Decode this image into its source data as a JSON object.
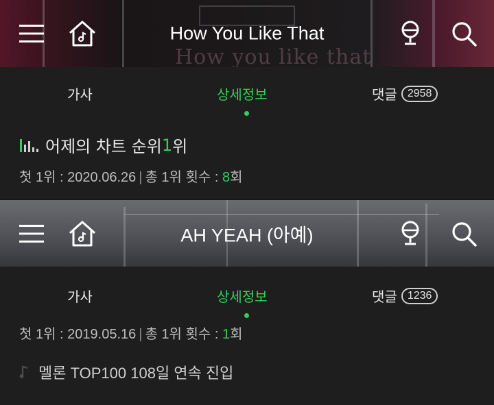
{
  "panels": [
    {
      "header": {
        "title": "How You Like That",
        "poster_text": "How you like that",
        "icons": [
          "menu-icon",
          "home-icon",
          "mic-icon",
          "search-icon"
        ]
      },
      "tabs": {
        "lyrics": "가사",
        "detail": "상세정보",
        "comments": "댓글",
        "comment_count": "2958",
        "active": "detail"
      },
      "chart_rank": {
        "prefix": "어제의 차트 순위 ",
        "rank": "1",
        "suffix": "위"
      },
      "first_no1": {
        "label": "첫 1위 : ",
        "date": "2020.06.26",
        "total_label": "총 1위 횟수 : ",
        "count": "8",
        "count_suffix": "회"
      }
    },
    {
      "header": {
        "title": "AH YEAH (아예)",
        "icons": [
          "menu-icon",
          "home-icon",
          "mic-icon",
          "search-icon"
        ]
      },
      "tabs": {
        "lyrics": "가사",
        "detail": "상세정보",
        "comments": "댓글",
        "comment_count": "1236",
        "active": "detail"
      },
      "first_no1": {
        "label": "첫 1위 : ",
        "date": "2019.05.16",
        "total_label": "총 1위 횟수 : ",
        "count": "1",
        "count_suffix": "회"
      },
      "streak": {
        "text": "멜론 TOP100 108일 연속 진입"
      }
    }
  ],
  "colors": {
    "accent": "#2fd15a",
    "background": "#1e1e1e",
    "text": "#e6e6e6"
  }
}
